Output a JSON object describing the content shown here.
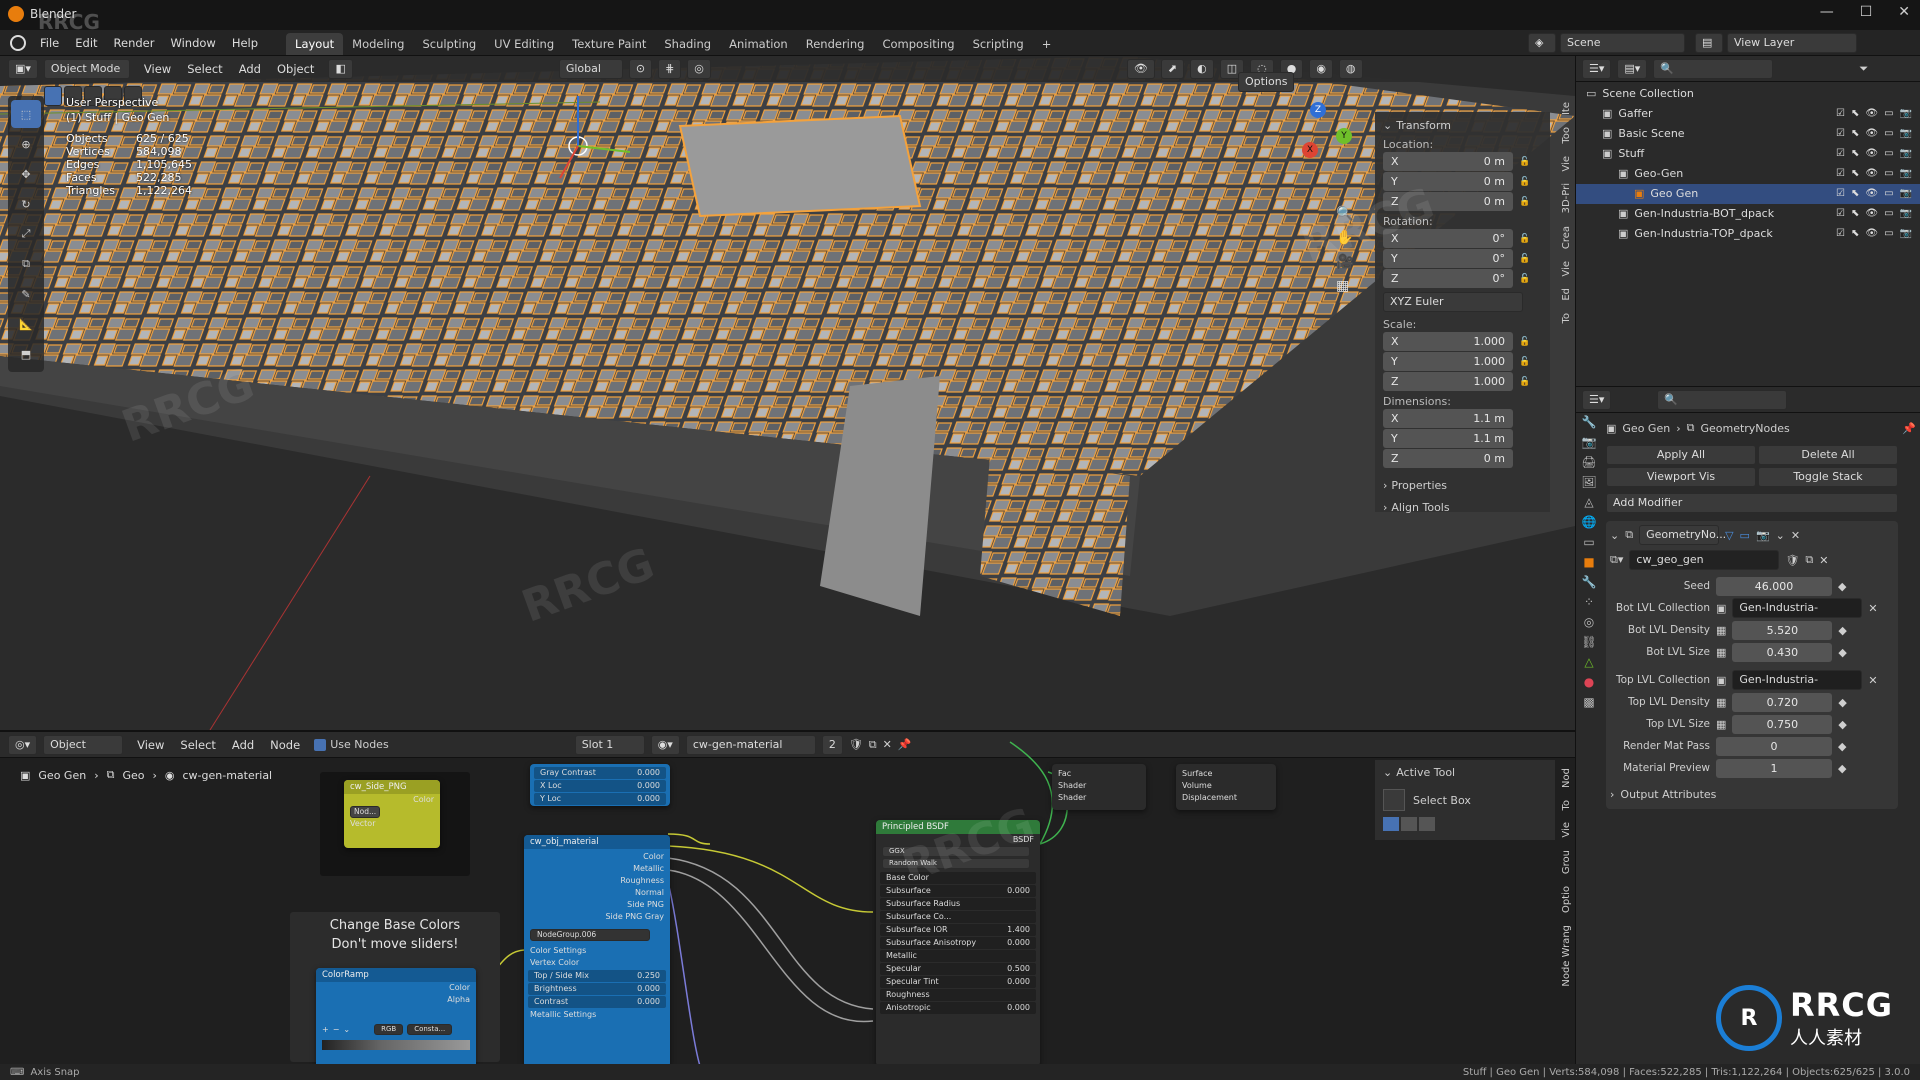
{
  "app": {
    "title": "Blender",
    "watermark_top": "RRCG"
  },
  "menu": {
    "items": [
      "File",
      "Edit",
      "Render",
      "Window",
      "Help"
    ]
  },
  "workspaces": {
    "tabs": [
      "Layout",
      "Modeling",
      "Sculpting",
      "UV Editing",
      "Texture Paint",
      "Shading",
      "Animation",
      "Rendering",
      "Compositing",
      "Scripting"
    ],
    "active": "Layout",
    "add": "+"
  },
  "top_right": {
    "scene": "Scene",
    "view_layer": "View Layer"
  },
  "viewport_header": {
    "mode": "Object Mode",
    "menus": [
      "View",
      "Select",
      "Add",
      "Object"
    ],
    "orientation": "Global",
    "options": "Options"
  },
  "viewport_info": {
    "perspective": "User Perspective",
    "collection": "(1) Stuff | Geo Gen",
    "stats": [
      {
        "label": "Objects",
        "value": "625 / 625"
      },
      {
        "label": "Vertices",
        "value": "584,098"
      },
      {
        "label": "Edges",
        "value": "1,105,645"
      },
      {
        "label": "Faces",
        "value": "522,285"
      },
      {
        "label": "Triangles",
        "value": "1,122,264"
      }
    ]
  },
  "n_panel": {
    "transform_title": "Transform",
    "location_label": "Location:",
    "location": [
      {
        "axis": "X",
        "value": "0 m"
      },
      {
        "axis": "Y",
        "value": "0 m"
      },
      {
        "axis": "Z",
        "value": "0 m"
      }
    ],
    "rotation_label": "Rotation:",
    "rotation": [
      {
        "axis": "X",
        "value": "0°"
      },
      {
        "axis": "Y",
        "value": "0°"
      },
      {
        "axis": "Z",
        "value": "0°"
      }
    ],
    "rotation_mode": "XYZ Euler",
    "scale_label": "Scale:",
    "scale": [
      {
        "axis": "X",
        "value": "1.000"
      },
      {
        "axis": "Y",
        "value": "1.000"
      },
      {
        "axis": "Z",
        "value": "1.000"
      }
    ],
    "dimensions_label": "Dimensions:",
    "dimensions": [
      {
        "axis": "X",
        "value": "1.1 m"
      },
      {
        "axis": "Y",
        "value": "1.1 m"
      },
      {
        "axis": "Z",
        "value": "0 m"
      }
    ],
    "properties": "Properties",
    "align_tools": "Align Tools",
    "tabs": [
      "Ite",
      "Too",
      "Vie",
      "3D-Pri",
      "Crea",
      "Vie",
      "Ed",
      "To"
    ]
  },
  "outliner": {
    "items": [
      {
        "name": "Scene Collection",
        "level": 0
      },
      {
        "name": "Gaffer",
        "level": 1
      },
      {
        "name": "Basic Scene",
        "level": 1
      },
      {
        "name": "Stuff",
        "level": 1
      },
      {
        "name": "Geo-Gen",
        "level": 2
      },
      {
        "name": "Geo Gen",
        "level": 3,
        "selected": true
      },
      {
        "name": "Gen-Industria-BOT_dpack",
        "level": 2
      },
      {
        "name": "Gen-Industria-TOP_dpack",
        "level": 2
      }
    ]
  },
  "properties": {
    "breadcrumb_obj": "Geo Gen",
    "breadcrumb_mod": "GeometryNodes",
    "apply_all": "Apply All",
    "delete_all": "Delete All",
    "viewport_vis": "Viewport Vis",
    "toggle_stack": "Toggle Stack",
    "add_modifier": "Add Modifier",
    "modifier_name": "GeometryNo...",
    "node_group": "cw_geo_gen",
    "fields": [
      {
        "label": "Seed",
        "value": "46.000",
        "kind": "num"
      },
      {
        "label": "Bot LVL Collection",
        "value": "Gen-Industria-BOT_...",
        "kind": "coll"
      },
      {
        "label": "Bot LVL Density",
        "value": "5.520",
        "kind": "numi"
      },
      {
        "label": "Bot LVL Size",
        "value": "0.430",
        "kind": "numi"
      },
      {
        "label": "Top LVL Collection",
        "value": "Gen-Industria-TOP_d...",
        "kind": "coll"
      },
      {
        "label": "Top LVL Density",
        "value": "0.720",
        "kind": "numi"
      },
      {
        "label": "Top LVL Size",
        "value": "0.750",
        "kind": "numi"
      },
      {
        "label": "Render Mat Pass",
        "value": "0",
        "kind": "num"
      },
      {
        "label": "Material Preview",
        "value": "1",
        "kind": "num"
      }
    ],
    "output_attributes": "Output Attributes"
  },
  "node_editor": {
    "type": "Object",
    "menus": [
      "View",
      "Select",
      "Add",
      "Node"
    ],
    "use_nodes": "Use Nodes",
    "slot": "Slot 1",
    "material": "cw-gen-material",
    "users": "2",
    "breadcrumb": [
      "Geo Gen",
      "Geo",
      "cw-gen-material"
    ],
    "frame_text_1": "Change Base Colors",
    "frame_text_2": "Don't move sliders!",
    "tabs": [
      "Nod",
      "To",
      "Vie",
      "Grou",
      "Optio",
      "Node Wrang"
    ]
  },
  "nodes": {
    "side_png": {
      "title": "cw_Side_PNG",
      "out": "Color",
      "in": "Vector",
      "sub": "Nod..."
    },
    "top": {
      "rows": [
        {
          "k": "Gray Contrast",
          "v": "0.000"
        },
        {
          "k": "X Loc",
          "v": "0.000"
        },
        {
          "k": "Y Loc",
          "v": "0.000"
        }
      ]
    },
    "obj_material": {
      "title": "cw_obj_material",
      "outs": [
        "Color",
        "Metallic",
        "Roughness",
        "Normal",
        "Side PNG",
        "Side PNG Gray"
      ],
      "group": "NodeGroup.006",
      "ins": [
        "Color Settings",
        "Vertex Color"
      ],
      "rows": [
        {
          "k": "Top / Side Mix",
          "v": "0.250"
        },
        {
          "k": "Brightness",
          "v": "0.000"
        },
        {
          "k": "Contrast",
          "v": "0.000"
        }
      ],
      "footer": "Metallic Settings"
    },
    "colorramp": {
      "title": "ColorRamp",
      "outs": [
        "Color",
        "Alpha"
      ],
      "mode": "RGB",
      "interp": "Consta..."
    },
    "bsdf": {
      "title": "Principled BSDF",
      "out": "BSDF",
      "dist": "GGX",
      "ss_method": "Random Walk",
      "rows": [
        {
          "k": "Base Color",
          "v": ""
        },
        {
          "k": "Subsurface",
          "v": "0.000"
        },
        {
          "k": "Subsurface Radius",
          "v": ""
        },
        {
          "k": "Subsurface Co...",
          "v": ""
        },
        {
          "k": "Subsurface IOR",
          "v": "1.400"
        },
        {
          "k": "Subsurface Anisotropy",
          "v": "0.000"
        },
        {
          "k": "Metallic",
          "v": ""
        },
        {
          "k": "Specular",
          "v": "0.500"
        },
        {
          "k": "Specular Tint",
          "v": "0.000"
        },
        {
          "k": "Roughness",
          "v": ""
        },
        {
          "k": "Anisotropic",
          "v": "0.000"
        }
      ]
    },
    "mix": {
      "rows": [
        "Fac",
        "Shader",
        "Shader"
      ]
    },
    "output": {
      "rows": [
        "Surface",
        "Volume",
        "Displacement"
      ]
    }
  },
  "active_tool": {
    "title": "Active Tool",
    "tool": "Select Box"
  },
  "statusbar": {
    "left": "Axis Snap",
    "right": "Stuff | Geo Gen | Verts:584,098 | Faces:522,285 | Tris:1,122,264 | Objects:625/625 | 3.0.0"
  },
  "logo": {
    "line1": "RRCG",
    "line2": "人人素材"
  },
  "colors": {
    "accent": "#4772b3",
    "selection": "#f4a23c",
    "node_blue": "#1a6fb3",
    "node_green": "#2f7a3a",
    "node_yellow": "#c6c935"
  }
}
